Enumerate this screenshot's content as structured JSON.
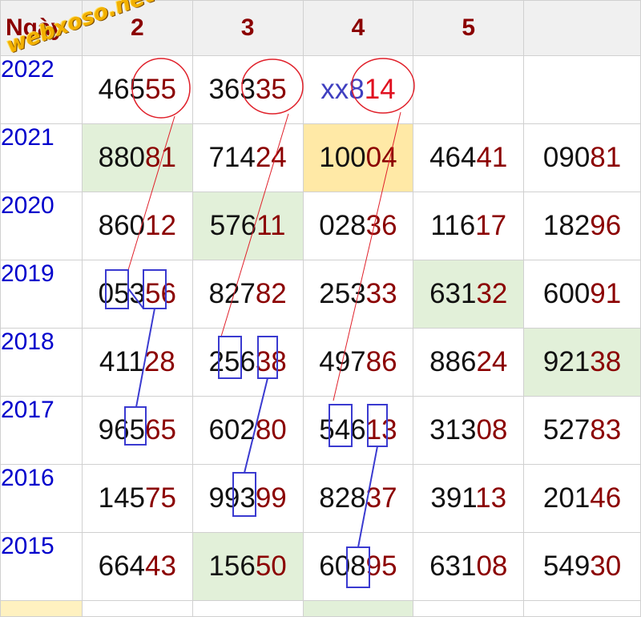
{
  "header": {
    "first": "Ngày",
    "cols": [
      "2",
      "3",
      "4",
      "5"
    ]
  },
  "watermark": "webxoso.net",
  "rows": [
    {
      "year": "2022",
      "cells": [
        {
          "head": "465",
          "tail": "55",
          "bg": ""
        },
        {
          "head": "363",
          "tail": "35",
          "bg": ""
        },
        {
          "head": "xx8",
          "tail": "14",
          "bg": "",
          "style": "pred"
        },
        {
          "head": "",
          "tail": "",
          "bg": ""
        },
        {
          "head": "",
          "tail": "",
          "bg": ""
        }
      ]
    },
    {
      "year": "2021",
      "cells": [
        {
          "head": "880",
          "tail": "81",
          "bg": "green"
        },
        {
          "head": "714",
          "tail": "24",
          "bg": ""
        },
        {
          "head": "100",
          "tail": "04",
          "bg": "yellow"
        },
        {
          "head": "464",
          "tail": "41",
          "bg": ""
        },
        {
          "head": "090",
          "tail": "81",
          "bg": ""
        }
      ]
    },
    {
      "year": "2020",
      "cells": [
        {
          "head": "860",
          "tail": "12",
          "bg": ""
        },
        {
          "head": "576",
          "tail": "11",
          "bg": "green"
        },
        {
          "head": "028",
          "tail": "36",
          "bg": ""
        },
        {
          "head": "116",
          "tail": "17",
          "bg": ""
        },
        {
          "head": "182",
          "tail": "96",
          "bg": ""
        }
      ]
    },
    {
      "year": "2019",
      "cells": [
        {
          "head": "053",
          "tail": "56",
          "bg": ""
        },
        {
          "head": "827",
          "tail": "82",
          "bg": ""
        },
        {
          "head": "253",
          "tail": "33",
          "bg": ""
        },
        {
          "head": "631",
          "tail": "32",
          "bg": "green"
        },
        {
          "head": "600",
          "tail": "91",
          "bg": ""
        }
      ]
    },
    {
      "year": "2018",
      "cells": [
        {
          "head": "411",
          "tail": "28",
          "bg": ""
        },
        {
          "head": "256",
          "tail": "38",
          "bg": ""
        },
        {
          "head": "497",
          "tail": "86",
          "bg": ""
        },
        {
          "head": "886",
          "tail": "24",
          "bg": ""
        },
        {
          "head": "921",
          "tail": "38",
          "bg": "green"
        }
      ]
    },
    {
      "year": "2017",
      "cells": [
        {
          "head": "965",
          "tail": "65",
          "bg": ""
        },
        {
          "head": "602",
          "tail": "80",
          "bg": ""
        },
        {
          "head": "546",
          "tail": "13",
          "bg": ""
        },
        {
          "head": "313",
          "tail": "08",
          "bg": ""
        },
        {
          "head": "527",
          "tail": "83",
          "bg": ""
        }
      ]
    },
    {
      "year": "2016",
      "cells": [
        {
          "head": "145",
          "tail": "75",
          "bg": ""
        },
        {
          "head": "993",
          "tail": "99",
          "bg": ""
        },
        {
          "head": "828",
          "tail": "37",
          "bg": ""
        },
        {
          "head": "391",
          "tail": "13",
          "bg": ""
        },
        {
          "head": "201",
          "tail": "46",
          "bg": ""
        }
      ]
    },
    {
      "year": "2015",
      "cells": [
        {
          "head": "664",
          "tail": "43",
          "bg": ""
        },
        {
          "head": "156",
          "tail": "50",
          "bg": "green"
        },
        {
          "head": "608",
          "tail": "95",
          "bg": ""
        },
        {
          "head": "631",
          "tail": "08",
          "bg": ""
        },
        {
          "head": "549",
          "tail": "30",
          "bg": ""
        }
      ]
    }
  ],
  "colors": {
    "header_text": "#8b0000",
    "year_text": "#0000cc",
    "tail_text": "#8b0000",
    "circle": "#e0202a",
    "box": "#3a3ad0",
    "green_bg": "#e2f0d9",
    "yellow_bg": "#ffe9a6"
  }
}
